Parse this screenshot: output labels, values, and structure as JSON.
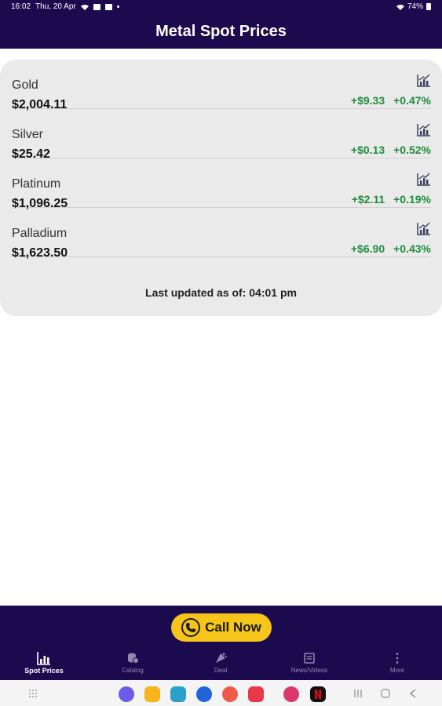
{
  "status_bar": {
    "time": "16:02",
    "date": "Thu, 20 Apr",
    "battery": "74%"
  },
  "header": {
    "title": "Metal Spot Prices"
  },
  "metals": [
    {
      "name": "Gold",
      "price": "$2,004.11",
      "change": "+$9.33",
      "percent": "+0.47%"
    },
    {
      "name": "Silver",
      "price": "$25.42",
      "change": "+$0.13",
      "percent": "+0.52%"
    },
    {
      "name": "Platinum",
      "price": "$1,096.25",
      "change": "+$2.11",
      "percent": "+0.19%"
    },
    {
      "name": "Palladium",
      "price": "$1,623.50",
      "change": "+$6.90",
      "percent": "+0.43%"
    }
  ],
  "last_updated": "Last updated as of: 04:01 pm",
  "call_button": {
    "label": "Call Now",
    "icon": "phone-icon"
  },
  "tabs": [
    {
      "label": "Spot Prices",
      "icon": "chart-icon",
      "active": true
    },
    {
      "label": "Catalog",
      "icon": "coins-icon",
      "active": false
    },
    {
      "label": "Deal",
      "icon": "deal-icon",
      "active": false
    },
    {
      "label": "News/Videos",
      "icon": "news-icon",
      "active": false
    },
    {
      "label": "More",
      "icon": "more-icon",
      "active": false
    }
  ],
  "colors": {
    "brand": "#1c0a4f",
    "accent": "#f6c519",
    "positive": "#1f8c3c",
    "card": "#eaeaea"
  }
}
